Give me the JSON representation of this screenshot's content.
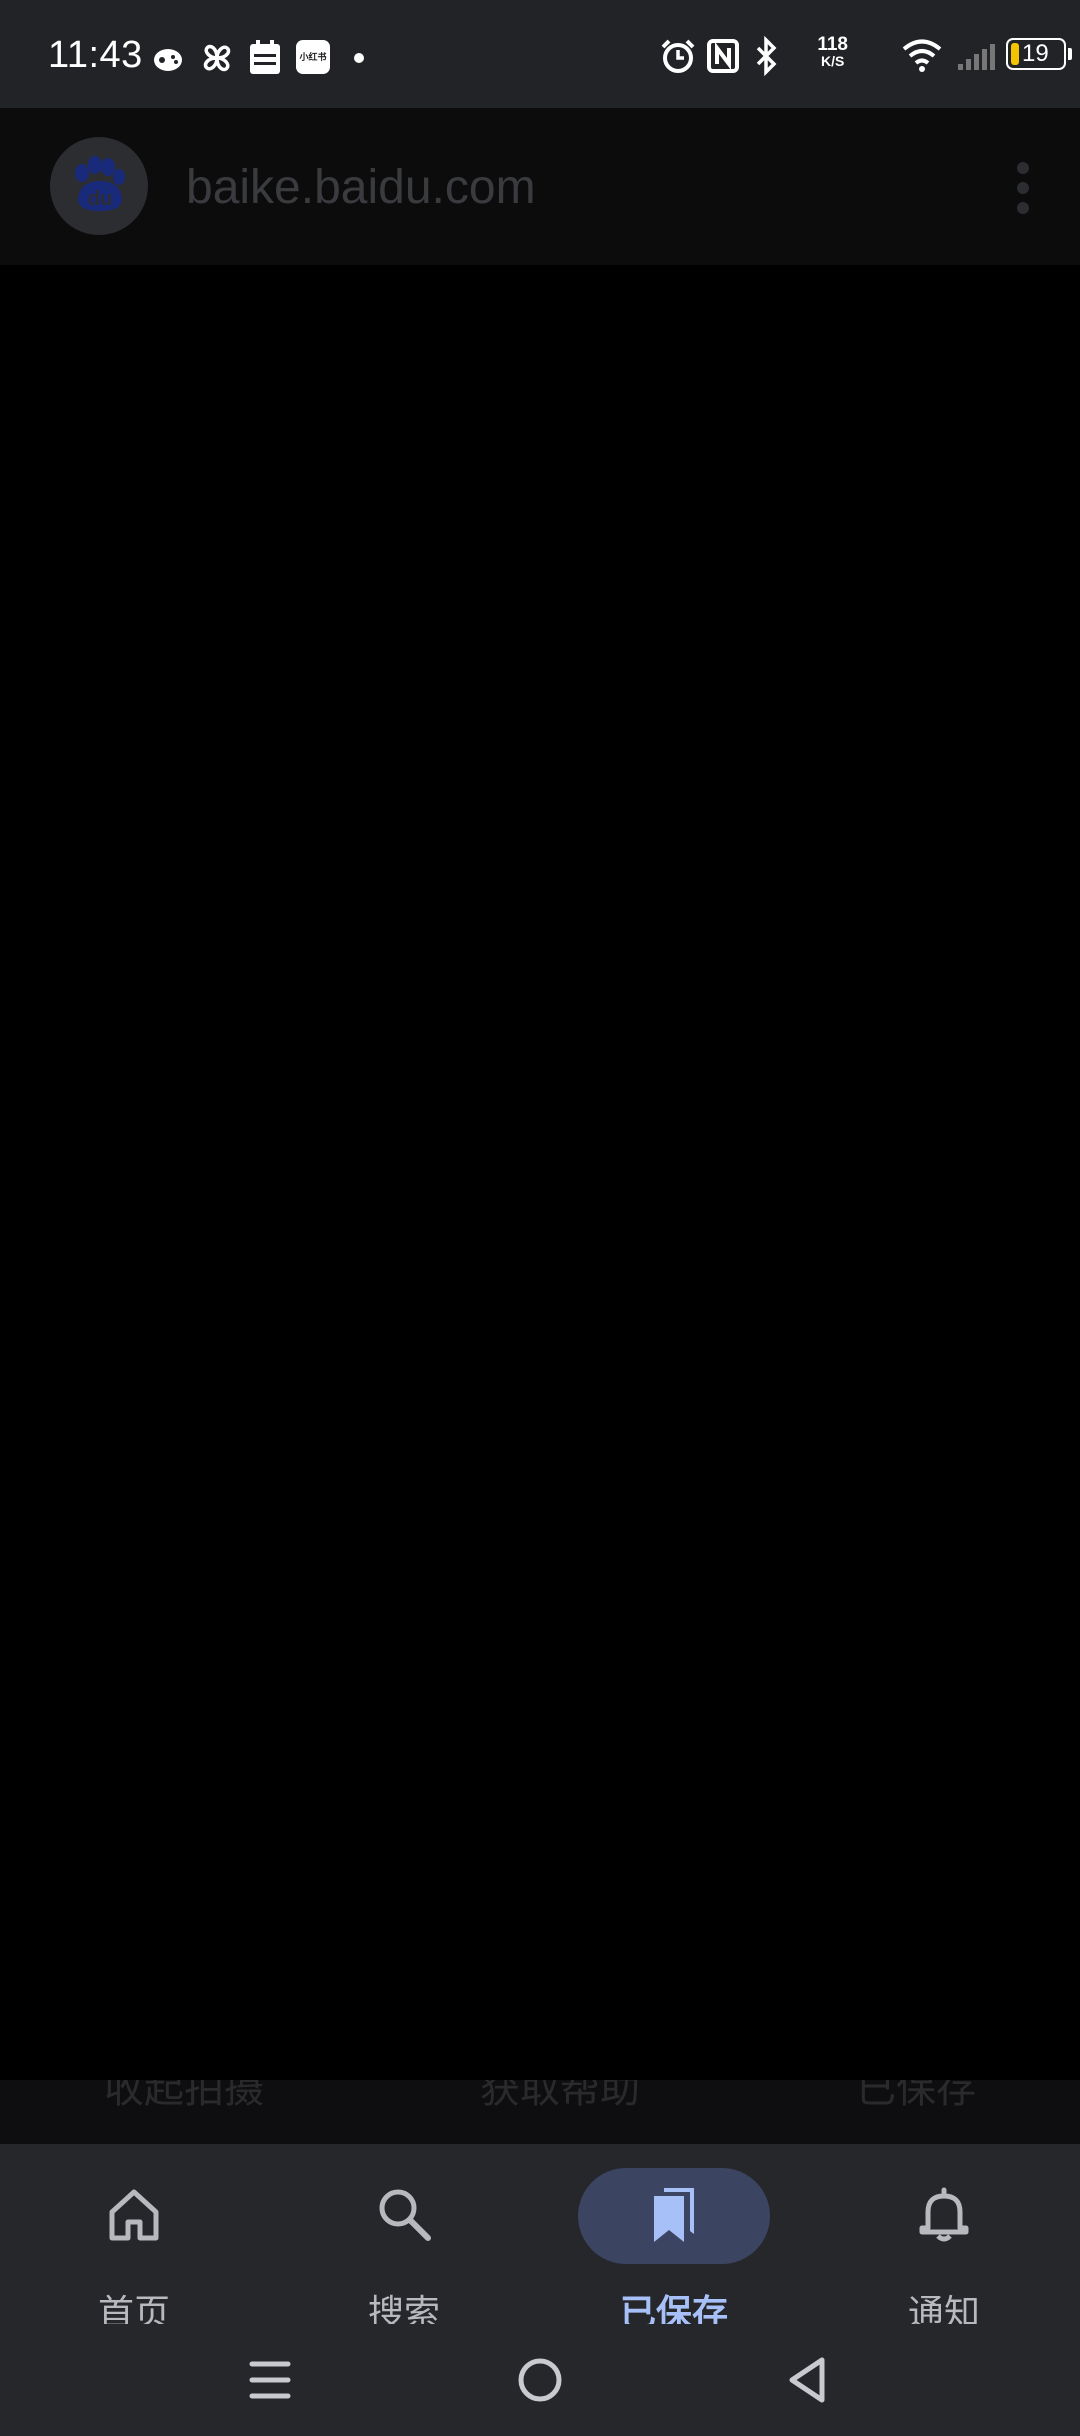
{
  "status_bar": {
    "time": "11:43",
    "net_speed_value": "118",
    "net_speed_unit": "K/S",
    "battery_level": "19",
    "notification_icons": [
      "game-controller-icon",
      "pinwheel-icon",
      "calendar-icon",
      "xiaohongshu-icon",
      "dot-icon"
    ],
    "system_icons": [
      "alarm-icon",
      "nfc-icon",
      "bluetooth-icon",
      "wifi-icon",
      "signal-icon",
      "battery-icon"
    ],
    "xiaohongshu_text": "小红书"
  },
  "url_bar": {
    "site_icon": "baidu-paw-icon",
    "site_icon_text": "du",
    "url": "baike.baidu.com",
    "menu_icon": "more-vertical-icon"
  },
  "behind_row": {
    "items": [
      "收起拍摄",
      "获取帮助",
      "已保存"
    ]
  },
  "bottom_nav": {
    "items": [
      {
        "label": "首页",
        "icon": "home-icon",
        "active": false
      },
      {
        "label": "搜索",
        "icon": "search-icon",
        "active": false
      },
      {
        "label": "已保存",
        "icon": "bookmarks-icon",
        "active": true
      },
      {
        "label": "通知",
        "icon": "bell-icon",
        "active": false
      }
    ]
  },
  "system_nav": {
    "items": [
      "menu-icon",
      "home-circle-icon",
      "back-icon"
    ]
  },
  "colors": {
    "status_bar_bg": "#222326",
    "nav_bg": "#26272b",
    "active_accent": "#a7c1f8",
    "active_pill": "#3b4460",
    "baidu_blue": "#1a2a7a",
    "battery_low": "#f5c400"
  }
}
